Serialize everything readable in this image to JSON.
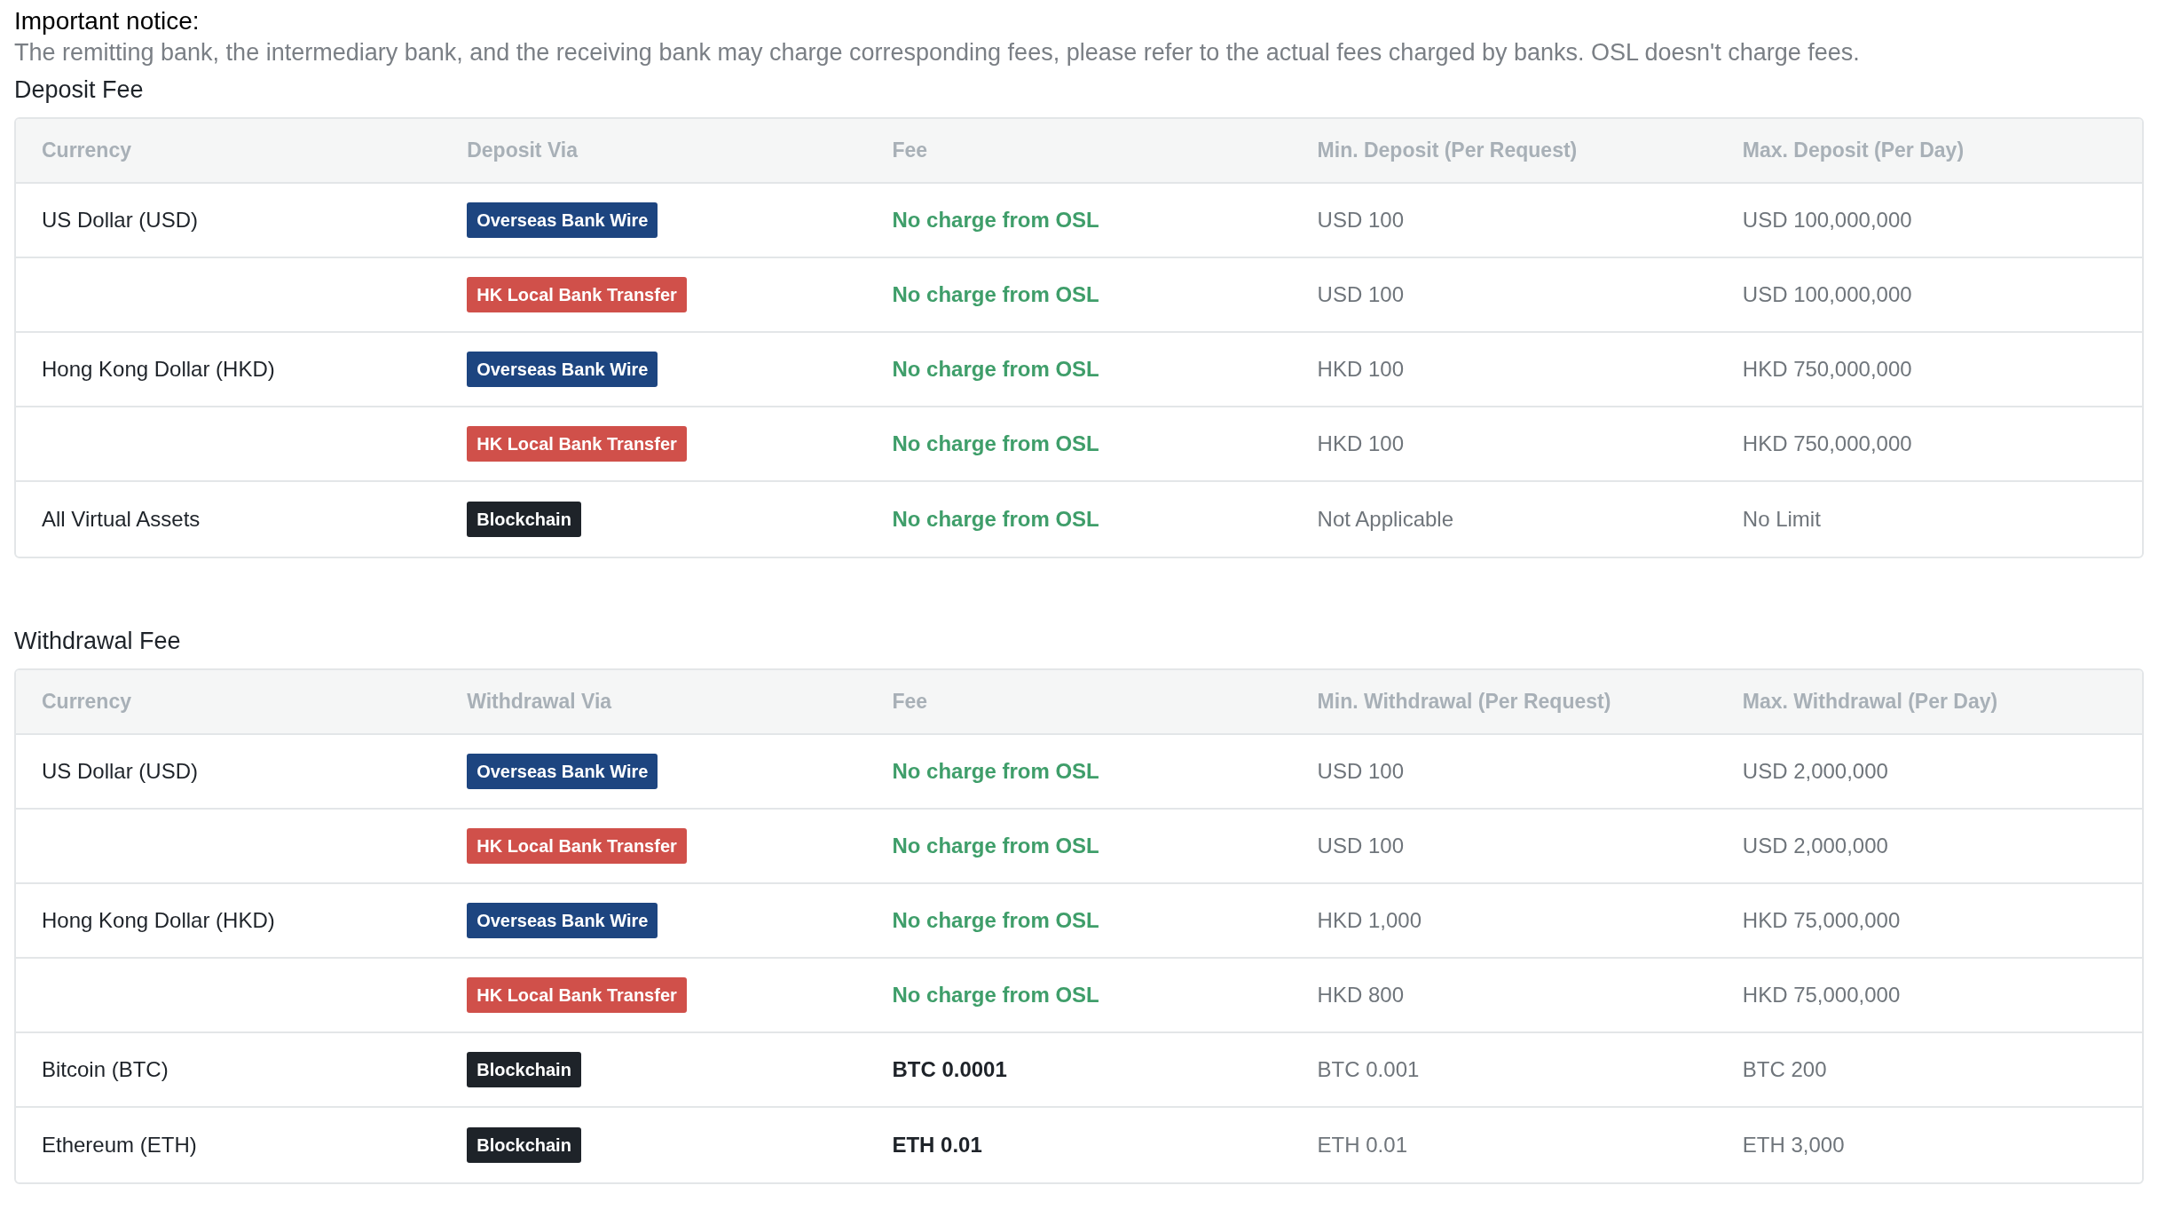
{
  "notice": {
    "title": "Important notice:",
    "text": "The remitting bank, the intermediary bank, and the receiving bank may charge corresponding fees, please refer to the actual fees charged by banks. OSL doesn't charge fees."
  },
  "sections": [
    {
      "title": "Deposit Fee",
      "columns": [
        "Currency",
        "Deposit Via",
        "Fee",
        "Min. Deposit (Per Request)",
        "Max. Deposit (Per Day)"
      ],
      "rows": [
        {
          "currency": "US Dollar (USD)",
          "via": {
            "label": "Overseas Bank Wire",
            "kind": "wire"
          },
          "fee": {
            "text": "No charge from OSL",
            "kind": "free"
          },
          "min": "USD 100",
          "max": "USD 100,000,000"
        },
        {
          "via": {
            "label": "HK Local Bank Transfer",
            "kind": "local"
          },
          "fee": {
            "text": "No charge from OSL",
            "kind": "free"
          },
          "min": "USD 100",
          "max": "USD 100,000,000"
        },
        {
          "currency": "Hong Kong Dollar (HKD)",
          "via": {
            "label": "Overseas Bank Wire",
            "kind": "wire"
          },
          "fee": {
            "text": "No charge from OSL",
            "kind": "free"
          },
          "min": "HKD 100",
          "max": "HKD 750,000,000"
        },
        {
          "via": {
            "label": "HK Local Bank Transfer",
            "kind": "local"
          },
          "fee": {
            "text": "No charge from OSL",
            "kind": "free"
          },
          "min": "HKD 100",
          "max": "HKD 750,000,000"
        },
        {
          "currency": "All Virtual Assets",
          "via": {
            "label": "Blockchain",
            "kind": "chain"
          },
          "fee": {
            "text": "No charge from OSL",
            "kind": "free"
          },
          "min": "Not Applicable",
          "max": "No Limit"
        }
      ]
    },
    {
      "title": "Withdrawal Fee",
      "columns": [
        "Currency",
        "Withdrawal Via",
        "Fee",
        "Min. Withdrawal (Per Request)",
        "Max. Withdrawal (Per Day)"
      ],
      "rows": [
        {
          "currency": "US Dollar (USD)",
          "via": {
            "label": "Overseas Bank Wire",
            "kind": "wire"
          },
          "fee": {
            "text": "No charge from OSL",
            "kind": "free"
          },
          "min": "USD 100",
          "max": "USD 2,000,000"
        },
        {
          "via": {
            "label": "HK Local Bank Transfer",
            "kind": "local"
          },
          "fee": {
            "text": "No charge from OSL",
            "kind": "free"
          },
          "min": "USD 100",
          "max": "USD 2,000,000"
        },
        {
          "currency": "Hong Kong Dollar (HKD)",
          "via": {
            "label": "Overseas Bank Wire",
            "kind": "wire"
          },
          "fee": {
            "text": "No charge from OSL",
            "kind": "free"
          },
          "min": "HKD 1,000",
          "max": "HKD 75,000,000"
        },
        {
          "via": {
            "label": "HK Local Bank Transfer",
            "kind": "local"
          },
          "fee": {
            "text": "No charge from OSL",
            "kind": "free"
          },
          "min": "HKD 800",
          "max": "HKD 75,000,000"
        },
        {
          "currency": "Bitcoin (BTC)",
          "via": {
            "label": "Blockchain",
            "kind": "chain"
          },
          "fee": {
            "text": "BTC 0.0001",
            "kind": "amount"
          },
          "min": "BTC 0.001",
          "max": "BTC 200"
        },
        {
          "currency": "Ethereum (ETH)",
          "via": {
            "label": "Blockchain",
            "kind": "chain"
          },
          "fee": {
            "text": "ETH 0.01",
            "kind": "amount"
          },
          "min": "ETH 0.01",
          "max": "ETH 3,000"
        }
      ]
    }
  ]
}
